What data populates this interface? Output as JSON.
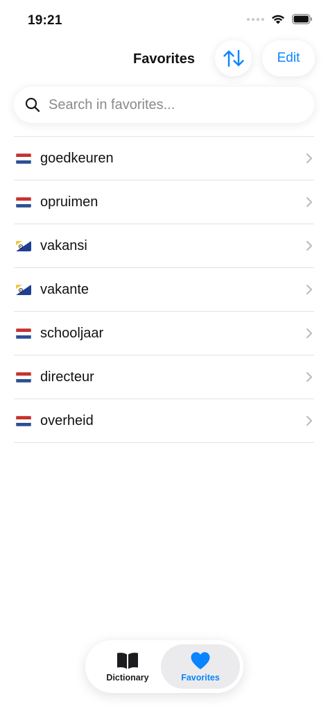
{
  "status_bar": {
    "time": "19:21"
  },
  "header": {
    "title": "Favorites",
    "edit_label": "Edit",
    "sort_icon": "sort-arrows-icon"
  },
  "search": {
    "placeholder": "Search in favorites...",
    "value": ""
  },
  "favorites": {
    "items": [
      {
        "word": "goedkeuren",
        "flag": "netherlands-flag"
      },
      {
        "word": "opruimen",
        "flag": "netherlands-flag"
      },
      {
        "word": "vakansi",
        "flag": "bonaire-flag"
      },
      {
        "word": "vakante",
        "flag": "bonaire-flag"
      },
      {
        "word": "schooljaar",
        "flag": "netherlands-flag"
      },
      {
        "word": "directeur",
        "flag": "netherlands-flag"
      },
      {
        "word": "overheid",
        "flag": "netherlands-flag"
      }
    ]
  },
  "tab_bar": {
    "tabs": [
      {
        "label": "Dictionary",
        "icon": "book-icon",
        "active": false
      },
      {
        "label": "Favorites",
        "icon": "heart-icon",
        "active": true
      }
    ]
  },
  "colors": {
    "accent": "#0a84ff",
    "divider": "#e3e3e6",
    "nl_red": "#c8312c",
    "nl_blue": "#2b4f94",
    "bonaire_yellow": "#f4c63d",
    "bonaire_blue": "#1e3f91"
  }
}
